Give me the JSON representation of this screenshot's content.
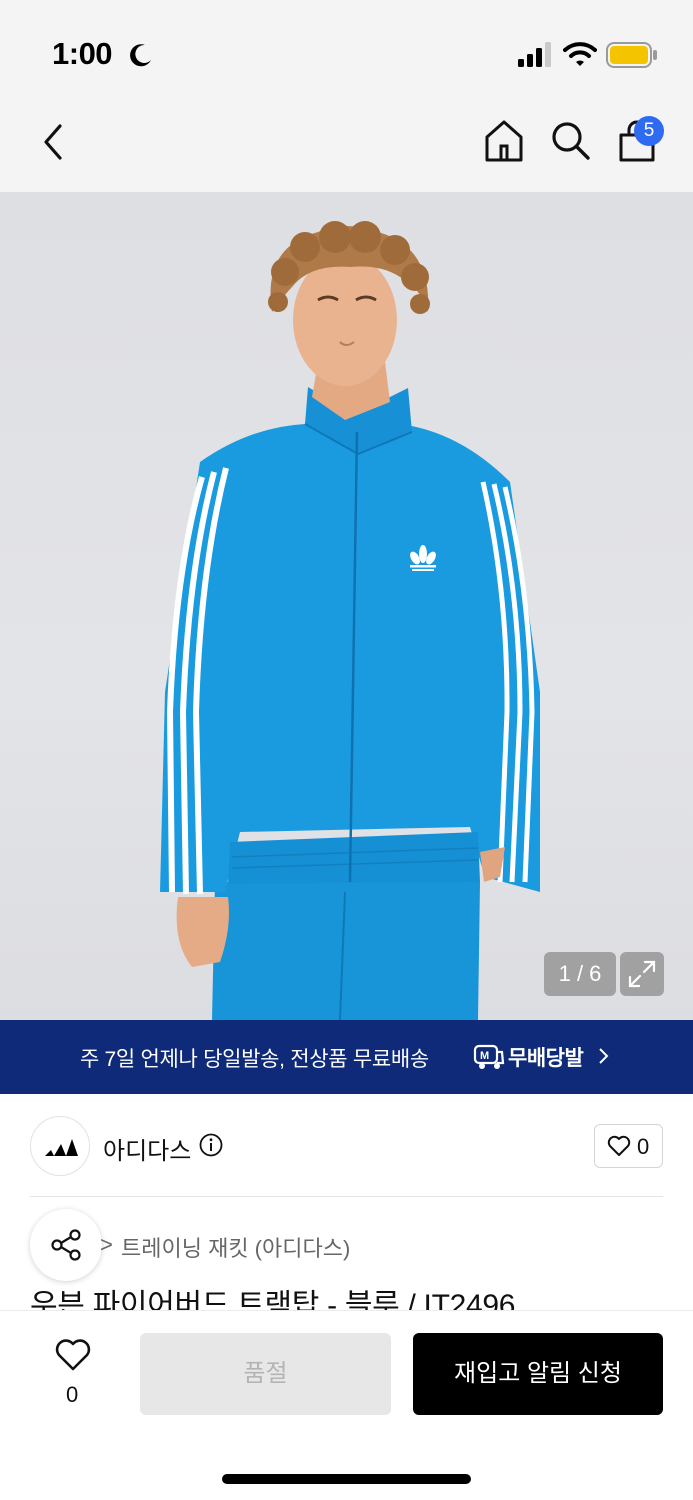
{
  "status_bar": {
    "time": "1:00"
  },
  "nav": {
    "cart_count": "5"
  },
  "gallery": {
    "counter": "1 / 6"
  },
  "promo": {
    "text": "주 7일 언제나 당일발송, 전상품 무료배송",
    "logo_text": "무배당발"
  },
  "brand": {
    "name": "아디다스",
    "wish_count": "0"
  },
  "breadcrumb": {
    "separator": ">",
    "category": "트레이닝 재킷 (아디다스)"
  },
  "product": {
    "title": "우븐 파이어버드 트랙탑 - 블루 / IT2496"
  },
  "action_bar": {
    "like_count": "0",
    "soldout_label": "품절",
    "restock_label": "재입고 알림 신청"
  },
  "colors": {
    "promo_bg": "#0e2a78",
    "badge": "#2f6bf2",
    "jacket": "#1a9be0"
  }
}
